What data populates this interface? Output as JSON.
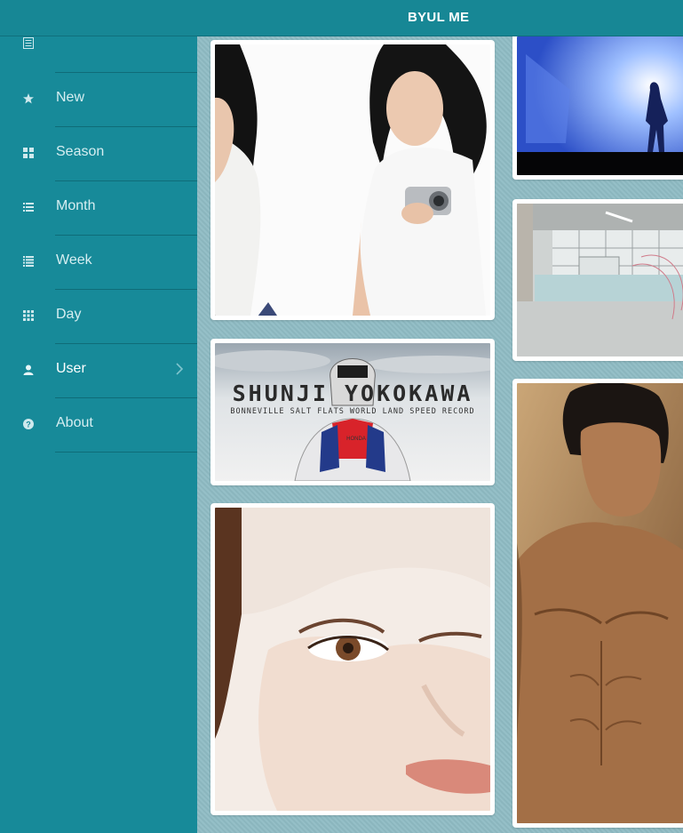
{
  "header": {
    "title": "BYUL ME"
  },
  "sidebar": {
    "top_icon": "list-icon",
    "items": [
      {
        "label": "New",
        "icon": "star-icon"
      },
      {
        "label": "Season",
        "icon": "grid-icon"
      },
      {
        "label": "Month",
        "icon": "list-icon"
      },
      {
        "label": "Week",
        "icon": "list-icon"
      },
      {
        "label": "Day",
        "icon": "grid-small-icon"
      },
      {
        "label": "User",
        "icon": "user-icon",
        "active": true,
        "has_submenu": true
      },
      {
        "label": "About",
        "icon": "help-icon"
      }
    ]
  },
  "photos": [
    {
      "desc": "woman with camera"
    },
    {
      "desc": "silhouette in blue light"
    },
    {
      "desc": "empty warehouse interior"
    },
    {
      "desc": "motorcycle helmet poster",
      "title": "SHUNJI YOKOKAWA",
      "subtitle": "BONNEVILLE SALT FLATS WORLD LAND SPEED RECORD",
      "brand": "HONDA"
    },
    {
      "desc": "close-up face portrait"
    },
    {
      "desc": "man portrait"
    }
  ],
  "colors": {
    "sidebar": "#178a99",
    "content_bg": "#8fbcc4",
    "accent_white": "#ffffff"
  }
}
